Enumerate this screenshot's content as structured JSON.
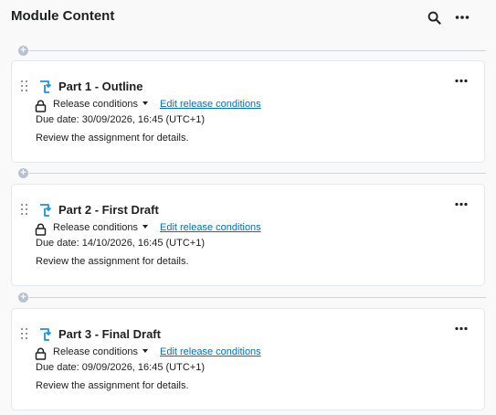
{
  "header": {
    "title": "Module Content",
    "search_icon": "search-icon",
    "more_icon": "more-horizontal-icon"
  },
  "colors": {
    "link": "#006fbf",
    "assignment_icon": "#1b94e0",
    "divider": "#cdd5dc",
    "text": "#202122"
  },
  "items": [
    {
      "title": "Part 1 - Outline",
      "release_label": "Release conditions",
      "edit_link": "Edit release conditions",
      "due": "Due date: 30/09/2026, 16:45 (UTC+1)",
      "description": "Review the assignment for details."
    },
    {
      "title": "Part 2 - First Draft",
      "release_label": "Release conditions",
      "edit_link": "Edit release conditions",
      "due": "Due date: 14/10/2026, 16:45 (UTC+1)",
      "description": "Review the assignment for details."
    },
    {
      "title": "Part 3 - Final Draft",
      "release_label": "Release conditions",
      "edit_link": "Edit release conditions",
      "due": "Due date: 09/09/2026, 16:45 (UTC+1)",
      "description": "Review the assignment for details."
    }
  ]
}
